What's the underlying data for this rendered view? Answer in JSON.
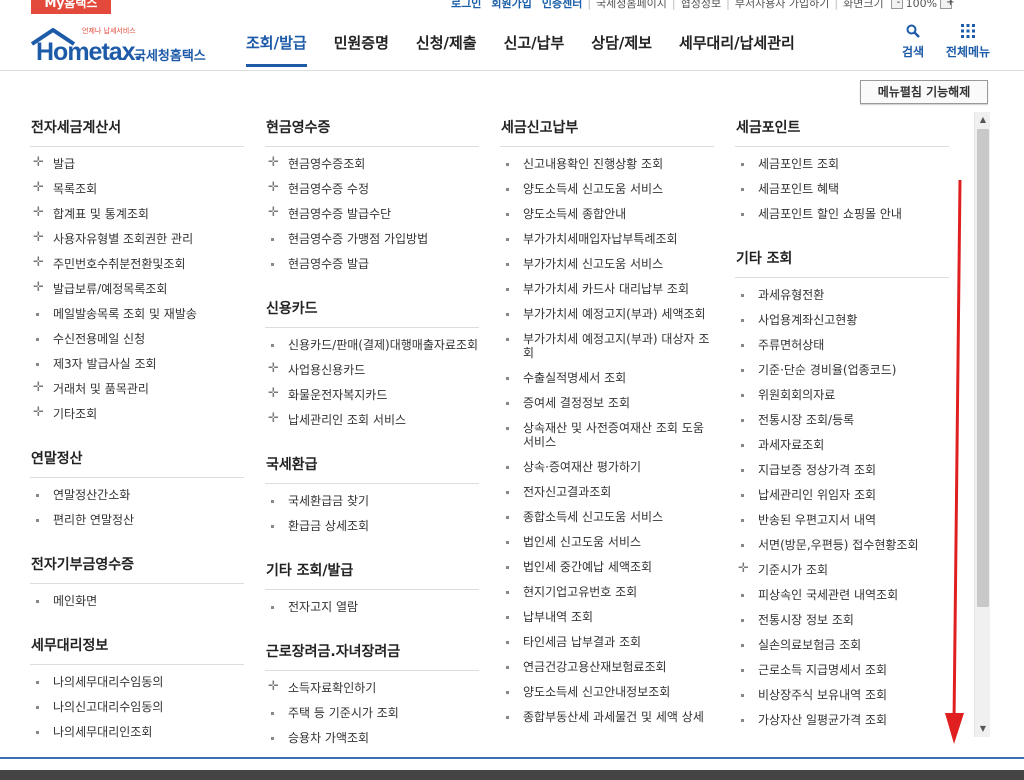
{
  "topbar": {
    "my_tab": "My홈택스",
    "links": [
      "로그인",
      "회원가입",
      "인증센터"
    ],
    "plain_links": [
      "국세청홈페이지",
      "협정정보",
      "부서사용자 가입하기",
      "화면크기"
    ],
    "zoom_minus": "-",
    "zoom_value": "100%",
    "zoom_plus": "+"
  },
  "header": {
    "logo_small": "언제나 납세서비스",
    "logo_text": "Hometax.",
    "logo_kr": "국세청홈택스",
    "nav": [
      "조회/발급",
      "민원증명",
      "신청/제출",
      "신고/납부",
      "상담/제보",
      "세무대리/납세관리"
    ],
    "search_label": "검색",
    "all_menu_label": "전체메뉴"
  },
  "collapse_button": "메뉴펼침 기능해제",
  "columns": [
    {
      "sections": [
        {
          "title": "전자세금계산서",
          "items": [
            {
              "label": "발급",
              "bullet": "plus"
            },
            {
              "label": "목록조회",
              "bullet": "plus"
            },
            {
              "label": "합계표 및 통계조회",
              "bullet": "plus"
            },
            {
              "label": "사용자유형별 조회권한 관리",
              "bullet": "plus"
            },
            {
              "label": "주민번호수취분전환및조회",
              "bullet": "plus"
            },
            {
              "label": "발급보류/예정목록조회",
              "bullet": "plus"
            },
            {
              "label": "메일발송목록 조회 및 재발송",
              "bullet": "dot"
            },
            {
              "label": "수신전용메일 신청",
              "bullet": "dot"
            },
            {
              "label": "제3자 발급사실 조회",
              "bullet": "dot"
            },
            {
              "label": "거래처 및 품목관리",
              "bullet": "plus"
            },
            {
              "label": "기타조회",
              "bullet": "plus"
            }
          ]
        },
        {
          "title": "연말정산",
          "items": [
            {
              "label": "연말정산간소화",
              "bullet": "dot"
            },
            {
              "label": "편리한 연말정산",
              "bullet": "dot"
            }
          ]
        },
        {
          "title": "전자기부금영수증",
          "items": [
            {
              "label": "메인화면",
              "bullet": "dot"
            }
          ]
        },
        {
          "title": "세무대리정보",
          "items": [
            {
              "label": "나의세무대리수임동의",
              "bullet": "dot"
            },
            {
              "label": "나의신고대리수임동의",
              "bullet": "dot"
            },
            {
              "label": "나의세무대리인조회",
              "bullet": "dot"
            }
          ]
        }
      ]
    },
    {
      "sections": [
        {
          "title": "현금영수증",
          "items": [
            {
              "label": "현금영수증조회",
              "bullet": "plus"
            },
            {
              "label": "현금영수증 수정",
              "bullet": "plus"
            },
            {
              "label": "현금영수증 발급수단",
              "bullet": "plus"
            },
            {
              "label": "현금영수증 가맹점 가입방법",
              "bullet": "dot"
            },
            {
              "label": "현금영수증 발급",
              "bullet": "dot"
            }
          ]
        },
        {
          "title": "신용카드",
          "items": [
            {
              "label": "신용카드/판매(결제)대행매출자료조회",
              "bullet": "dot"
            },
            {
              "label": "사업용신용카드",
              "bullet": "plus"
            },
            {
              "label": "화물운전자복지카드",
              "bullet": "plus"
            },
            {
              "label": "납세관리인 조회 서비스",
              "bullet": "plus"
            }
          ]
        },
        {
          "title": "국세환급",
          "items": [
            {
              "label": "국세환급금 찾기",
              "bullet": "dot"
            },
            {
              "label": "환급금 상세조회",
              "bullet": "dot"
            }
          ]
        },
        {
          "title": "기타 조회/발급",
          "items": [
            {
              "label": "전자고지 열람",
              "bullet": "dot"
            }
          ]
        },
        {
          "title": "근로장려금.자녀장려금",
          "items": [
            {
              "label": "소득자료확인하기",
              "bullet": "plus"
            },
            {
              "label": "주택 등 기준시가 조회",
              "bullet": "dot"
            },
            {
              "label": "승용차 가액조회",
              "bullet": "dot"
            }
          ]
        }
      ]
    },
    {
      "sections": [
        {
          "title": "세금신고납부",
          "items": [
            {
              "label": "신고내용확인 진행상황 조회",
              "bullet": "dot"
            },
            {
              "label": "양도소득세 신고도움 서비스",
              "bullet": "dot"
            },
            {
              "label": "양도소득세 종합안내",
              "bullet": "dot"
            },
            {
              "label": "부가가치세매입자납부특례조회",
              "bullet": "dot"
            },
            {
              "label": "부가가치세 신고도움 서비스",
              "bullet": "dot"
            },
            {
              "label": "부가가치세 카드사 대리납부 조회",
              "bullet": "dot"
            },
            {
              "label": "부가가치세 예정고지(부과) 세액조회",
              "bullet": "dot"
            },
            {
              "label": "부가가치세 예정고지(부과) 대상자 조회",
              "bullet": "dot"
            },
            {
              "label": "수출실적명세서 조회",
              "bullet": "dot"
            },
            {
              "label": "증여세 결정정보 조회",
              "bullet": "dot"
            },
            {
              "label": "상속재산 및 사전증여재산 조회 도움 서비스",
              "bullet": "dot"
            },
            {
              "label": "상속·증여재산 평가하기",
              "bullet": "dot"
            },
            {
              "label": "전자신고결과조회",
              "bullet": "dot"
            },
            {
              "label": "종합소득세 신고도움 서비스",
              "bullet": "dot"
            },
            {
              "label": "법인세 신고도움 서비스",
              "bullet": "dot"
            },
            {
              "label": "법인세 중간예납 세액조회",
              "bullet": "dot"
            },
            {
              "label": "현지기업고유번호 조회",
              "bullet": "dot"
            },
            {
              "label": "납부내역 조회",
              "bullet": "dot"
            },
            {
              "label": "타인세금 납부결과 조회",
              "bullet": "dot"
            },
            {
              "label": "연금건강고용산재보험료조회",
              "bullet": "dot"
            },
            {
              "label": "양도소득세 신고안내정보조회",
              "bullet": "dot"
            },
            {
              "label": "종합부동산세 과세물건 및 세액 상세",
              "bullet": "dot"
            }
          ]
        }
      ]
    },
    {
      "sections": [
        {
          "title": "세금포인트",
          "items": [
            {
              "label": "세금포인트 조회",
              "bullet": "dot"
            },
            {
              "label": "세금포인트 혜택",
              "bullet": "dot"
            },
            {
              "label": "세금포인트 할인 쇼핑몰 안내",
              "bullet": "dot"
            }
          ]
        },
        {
          "title": "기타 조회",
          "items": [
            {
              "label": "과세유형전환",
              "bullet": "dot"
            },
            {
              "label": "사업용계좌신고현황",
              "bullet": "dot"
            },
            {
              "label": "주류면허상태",
              "bullet": "dot"
            },
            {
              "label": "기준·단순 경비율(업종코드)",
              "bullet": "dot"
            },
            {
              "label": "위원회회의자료",
              "bullet": "dot"
            },
            {
              "label": "전통시장 조회/등록",
              "bullet": "dot"
            },
            {
              "label": "과세자료조회",
              "bullet": "dot"
            },
            {
              "label": "지급보증 정상가격 조회",
              "bullet": "dot"
            },
            {
              "label": "납세관리인 위임자 조회",
              "bullet": "dot"
            },
            {
              "label": "반송된 우편고지서 내역",
              "bullet": "dot"
            },
            {
              "label": "서면(방문,우편등) 접수현황조회",
              "bullet": "dot"
            },
            {
              "label": "기준시가 조회",
              "bullet": "plus"
            },
            {
              "label": "피상속인 국세관련 내역조회",
              "bullet": "dot"
            },
            {
              "label": "전통시장 정보 조회",
              "bullet": "dot"
            },
            {
              "label": "실손의료보험금 조회",
              "bullet": "dot"
            },
            {
              "label": "근로소득 지급명세서 조회",
              "bullet": "dot"
            },
            {
              "label": "비상장주식 보유내역 조회",
              "bullet": "dot"
            },
            {
              "label": "가상자산 일평균가격 조회",
              "bullet": "dot"
            }
          ]
        }
      ]
    }
  ],
  "colors": {
    "brand_blue": "#1d5aa8",
    "my_tab_red": "#e34a3c",
    "annotation_arrow": "#e02020"
  }
}
